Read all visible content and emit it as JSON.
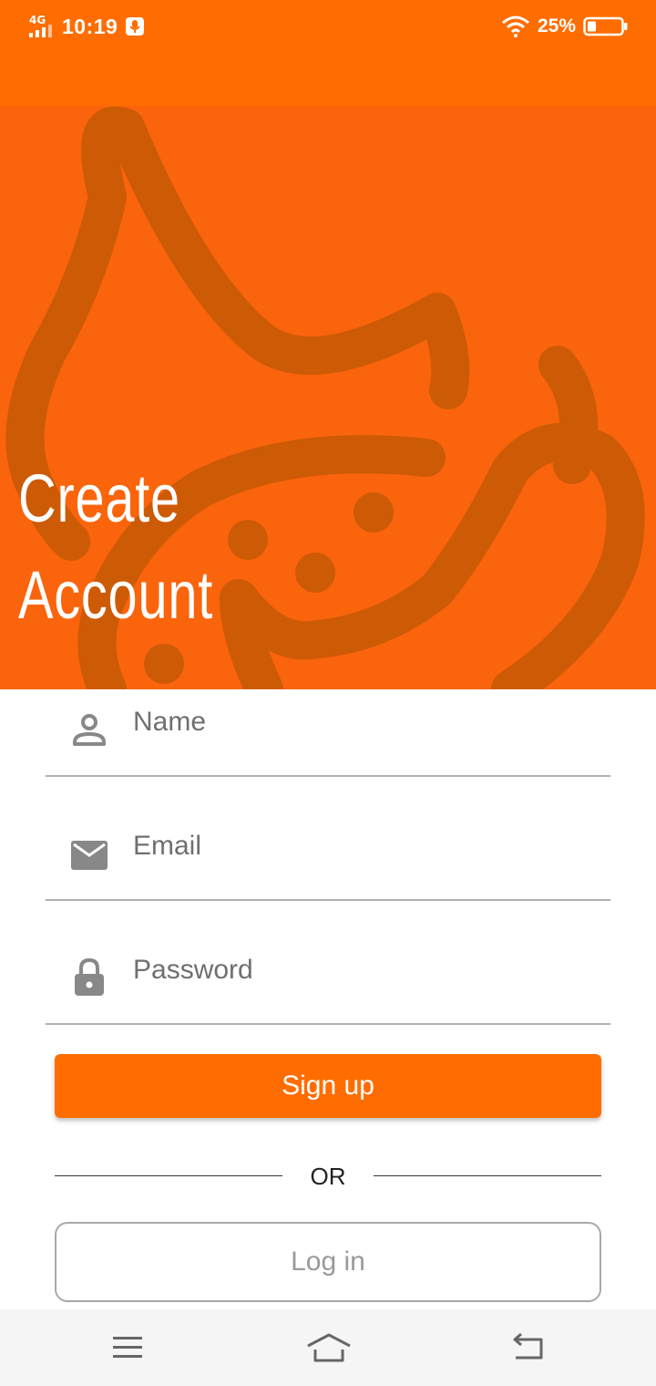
{
  "status_bar": {
    "network": "4G",
    "time": "10:19",
    "battery": "25%"
  },
  "hero": {
    "title_line1": "Create",
    "title_line2": "Account"
  },
  "form": {
    "name_placeholder": "Name",
    "email_placeholder": "Email",
    "password_placeholder": "Password",
    "signup_label": "Sign up",
    "divider_text": "OR",
    "login_label": "Log in"
  },
  "icons": {
    "name": "person-icon",
    "email": "mail-icon",
    "password": "lock-icon"
  },
  "colors": {
    "accent": "#ff6d00",
    "hero": "#fa640c",
    "decoration": "#cd5a05"
  }
}
